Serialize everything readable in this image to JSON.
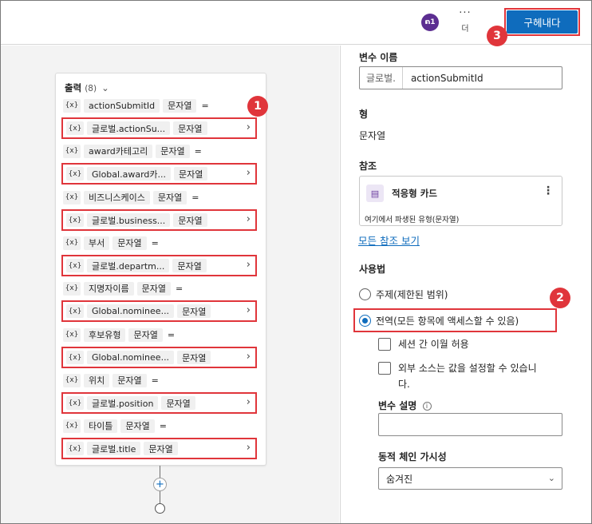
{
  "topbar": {
    "avatar_label": "ຄ1",
    "more_label": "더",
    "more_dots": "···",
    "publish_label": "구헤내다"
  },
  "callouts": [
    "1",
    "2",
    "3"
  ],
  "outputs": {
    "header": "출력",
    "count": "(8)",
    "tag": "{x}",
    "eq": "=",
    "chevron": "›",
    "items": [
      {
        "name": "actionSubmitId",
        "type": "문자열",
        "value": "글로벌.actionSu...",
        "value_type": "문자열"
      },
      {
        "name": "award카테고리",
        "type": "문자열",
        "value": "Global.award카...",
        "value_type": "문자열"
      },
      {
        "name": "비즈니스케이스",
        "type": "문자열",
        "value": "글로벌.business...",
        "value_type": "문자열"
      },
      {
        "name": "부서",
        "type": "문자열",
        "value": "글로벌.departm...",
        "value_type": "문자열"
      },
      {
        "name": "지명자이름",
        "type": "문자열",
        "value": "Global.nominee...",
        "value_type": "문자열"
      },
      {
        "name": "후보유형",
        "type": "문자열",
        "value": "Global.nominee...",
        "value_type": "문자열"
      },
      {
        "name": "위치",
        "type": "문자열",
        "value": "글로벌.position",
        "value_type": "문자열"
      },
      {
        "name": "타이틀",
        "type": "문자열",
        "value": "글로벌.title",
        "value_type": "문자열"
      }
    ]
  },
  "canvas": {
    "add_symbol": "+"
  },
  "panel": {
    "var_name_label": "변수 이름",
    "var_prefix": "글로벌.",
    "var_value": "actionSubmitId",
    "type_label": "형",
    "type_value": "문자열",
    "reference_label": "참조",
    "reference_card_title": "적응형 카드",
    "reference_card_menu": "⋮",
    "reference_card_sub": "여기에서 파생된 유형(문자열)",
    "view_all_refs": "모든 참조 보기",
    "usage_label": "사용법",
    "radio_topic": "주제(제한된 범위)",
    "radio_global": "전역(모든 항목에 액세스할 수 있음)",
    "check_session": "세션 간 이월 허용",
    "check_external_line1": "외부 소스는 값을 설정할 수 있습니",
    "check_external_line2": "다.",
    "desc_label": "변수 설명",
    "info_symbol": "i",
    "visibility_label": "동적 체인 가시성",
    "visibility_value": "숨겨진",
    "select_arrow": "⌄"
  }
}
